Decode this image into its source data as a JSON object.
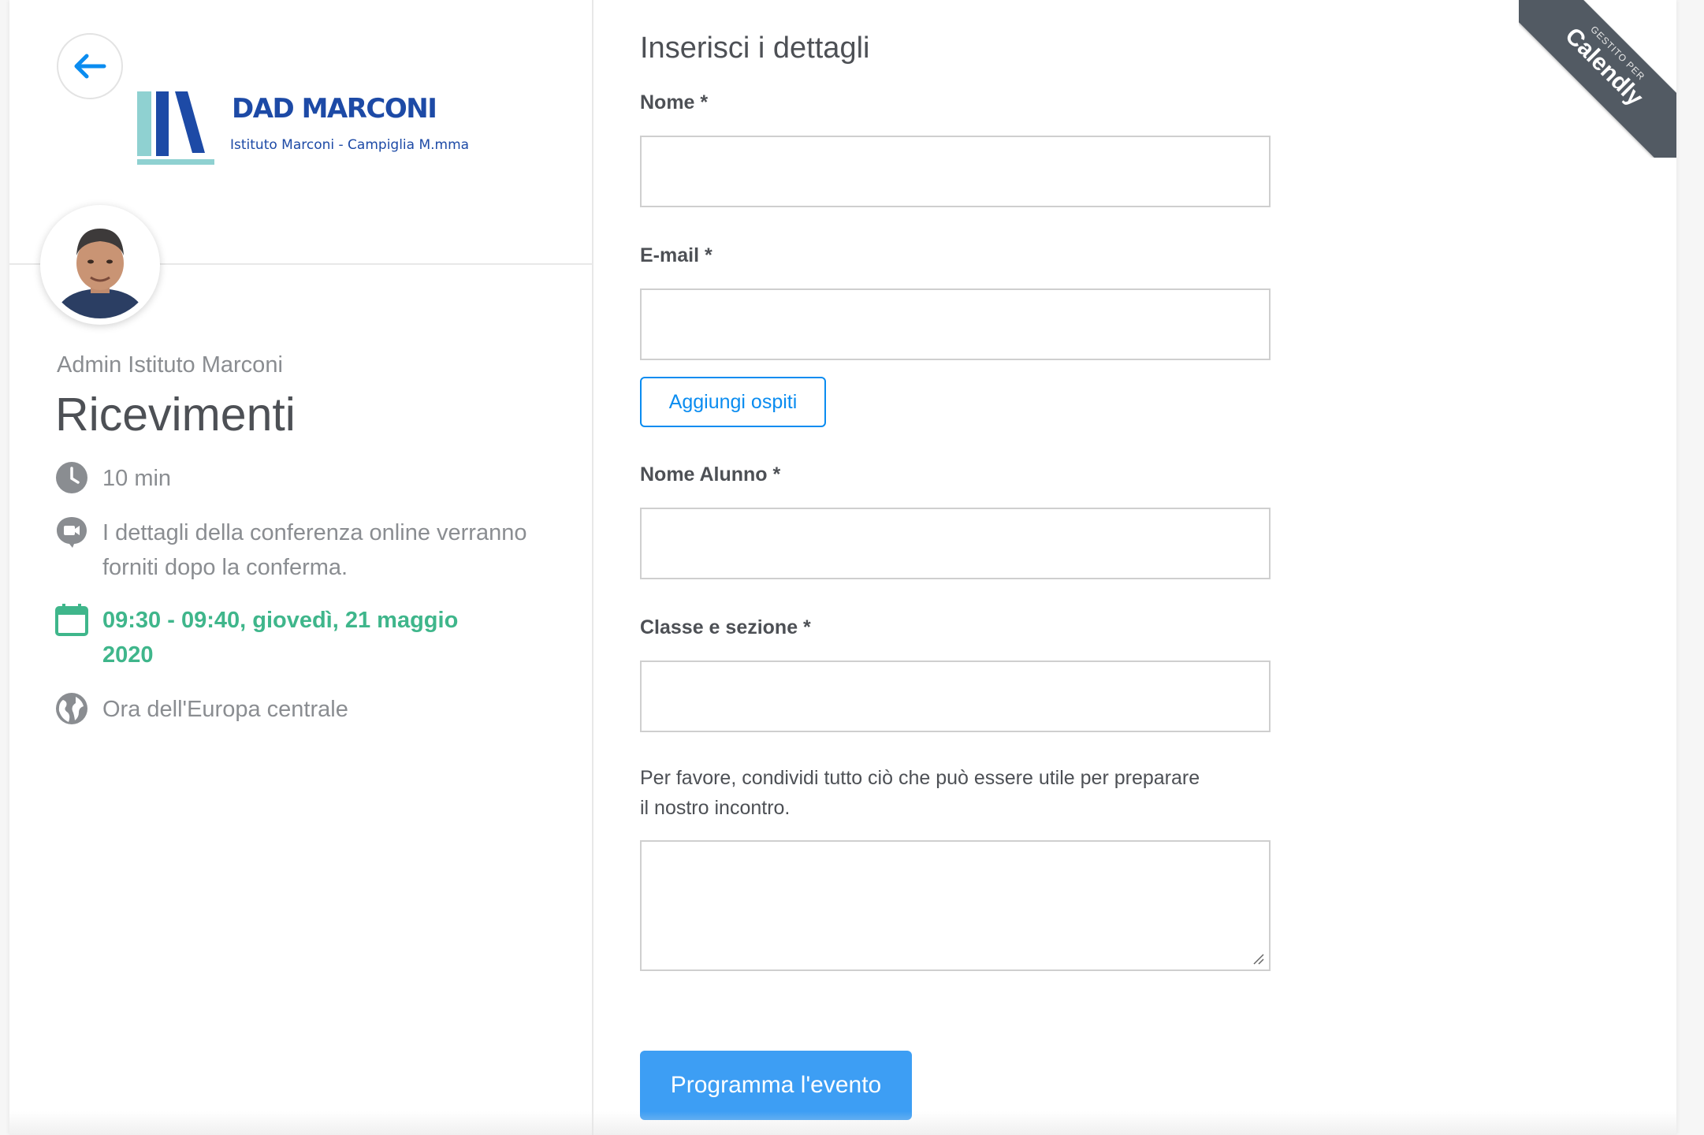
{
  "header": {
    "logo_title": "DAD MARCONI",
    "logo_subtitle": "Istituto Marconi - Campiglia M.mma"
  },
  "event": {
    "owner": "Admin Istituto Marconi",
    "title": "Ricevimenti",
    "duration": "10 min",
    "conference_note": "I dettagli della conferenza online verranno forniti dopo la conferma.",
    "datetime": "09:30 - 09:40, giovedì, 21 maggio 2020",
    "timezone": "Ora dell'Europa centrale"
  },
  "form": {
    "title": "Inserisci i dettagli",
    "name_label": "Nome *",
    "email_label": "E-mail *",
    "add_guests_label": "Aggiungi ospiti",
    "student_label": "Nome Alunno *",
    "class_label": "Classe e sezione *",
    "notes_label": "Per favore, condividi tutto ciò che può essere utile per preparare il nostro incontro.",
    "submit_label": "Programma l'evento"
  },
  "ribbon": {
    "small": "GESTITO PER",
    "brand": "Calendly"
  },
  "colors": {
    "accent_blue": "#0a8cf0",
    "button_blue": "#3d9ef4",
    "green": "#3fb68b",
    "logo_blue": "#1d4aa6",
    "logo_teal": "#8fd1d1"
  },
  "icons": {
    "back": "arrow-left-icon",
    "duration": "clock-icon",
    "conference": "video-chat-icon",
    "date": "calendar-icon",
    "timezone": "globe-icon"
  }
}
